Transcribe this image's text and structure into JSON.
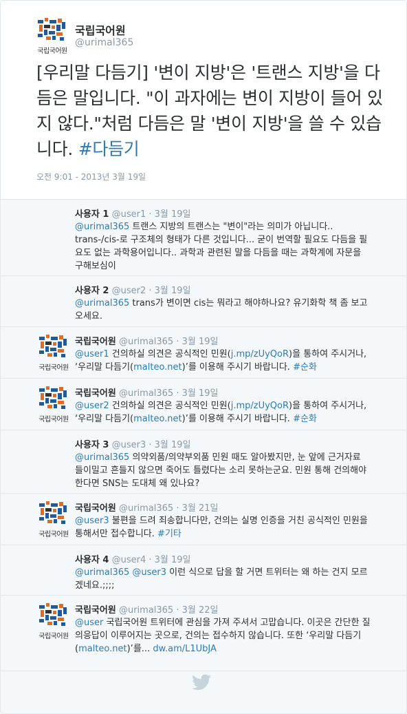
{
  "main_tweet": {
    "account_name": "국립국어원",
    "handle": "@urimal365",
    "logo_caption": "국립국어원",
    "text": "[우리말 다듬기] '변이 지방'은 '트랜스 지방'을 다듬은 말입니다. \"이 과자에는 변이 지방이 들어 있지 않다.\"처럼 다듬은 말 '변이 지방'을 쓸 수 있습니다.",
    "hashtag": "#다듬기",
    "timestamp": "오전 9:01 - 2013년 3월 19일"
  },
  "replies": [
    {
      "name": "사용자 1",
      "handle": "@user1",
      "date": "· 3월 19일",
      "mention": "@urimal365",
      "text": " 트랜스 지방의 트랜스는 \"변이\"라는 의미가 아닙니다.. trans-/cis-로 구조체의 형태가 다른 것입니다... 굳이 번역할 필요도 다듬을 필요도 없는 과학용어입니다.. 과학과 관련된 말을 다듬을 때는 과학계에 자문을 구해보심이"
    },
    {
      "name": "사용자 2",
      "handle": "@user2",
      "date": "· 3월 19일",
      "mention": "@urimal365",
      "text": " trans가 변이면 cis는 뭐라고 해야하나요? 유기화학 책 좀 보고 오세요."
    },
    {
      "name": "국립국어원",
      "handle": "@urimal365",
      "date": "· 3월 19일",
      "mention": "@user1",
      "text_a": " 건의하실 의견은 공식적인 민원(",
      "link1": "j.mp/zUyQoR",
      "text_b": ")을 통하여 주시거나, ‘우리말 다듬기(",
      "link2": "malteo.net",
      "text_c": ")’를 이용해 주시기 바랍니다. ",
      "hashtag": "#순화"
    },
    {
      "name": "국립국어원",
      "handle": "@urimal365",
      "date": "· 3월 19일",
      "mention": "@user2",
      "text_a": " 건의하실 의견은 공식적인 민원(",
      "link1": "j.mp/zUyQoR",
      "text_b": ")을 통하여 주시거나, ‘우리말 다듬기(",
      "link2": "malteo.net",
      "text_c": ")’를 이용해 주시기 바랍니다. ",
      "hashtag": "#순화"
    },
    {
      "name": "사용자 3",
      "handle": "@user3",
      "date": "· 3월 19일",
      "mention": "@urimal365",
      "text": " 의약외품/의약부외품 민원 때도 알아봤지만, 눈 앞에 근거자료 들이밀고 흔들지 않으면 죽어도 틀렸다는 소리 못하는군요. 민원 통해 건의해야 한다면 SNS는 도대체 왜 있나요?"
    },
    {
      "name": "국립국어원",
      "handle": "@urimal365",
      "date": "· 3월 21일",
      "mention": "@user3",
      "text": " 불편을 드려 죄송합니다만, 건의는 실명 인증을 거친 공식적인 민원을 통해서만 접수합니다. ",
      "hashtag": "#기타"
    },
    {
      "name": "사용자 4",
      "handle": "@user4",
      "date": "· 3월 19일",
      "mention": "@urimal365",
      "mention2": "@user3",
      "text": " 이런 식으로 답을 할 거면 트위터는 왜 하는 건지 모르겠네요.;;;;"
    },
    {
      "name": "국립국어원",
      "handle": "@urimal365",
      "date": "· 3월 22일",
      "mention": "@user",
      "text_a": " 국립국어원 트위터에 관심을 가져 주셔서 고맙습니다. 이곳은 간단한 질의응답이 이루어지는 곳으로, 건의는 접수하지 않습니다. 또한 ‘우리말 다듬기(",
      "link1": "malteo.net",
      "text_b": ")’를... ",
      "link2": "dw.am/L1UbJA"
    }
  ],
  "icons": {
    "logo": "nikl-logo-icon",
    "footer": "twitter-bird-icon"
  },
  "colors": {
    "link": "#2b7bb9",
    "muted": "#8899a6",
    "text": "#292f33",
    "bird": "#c8d4dc"
  }
}
